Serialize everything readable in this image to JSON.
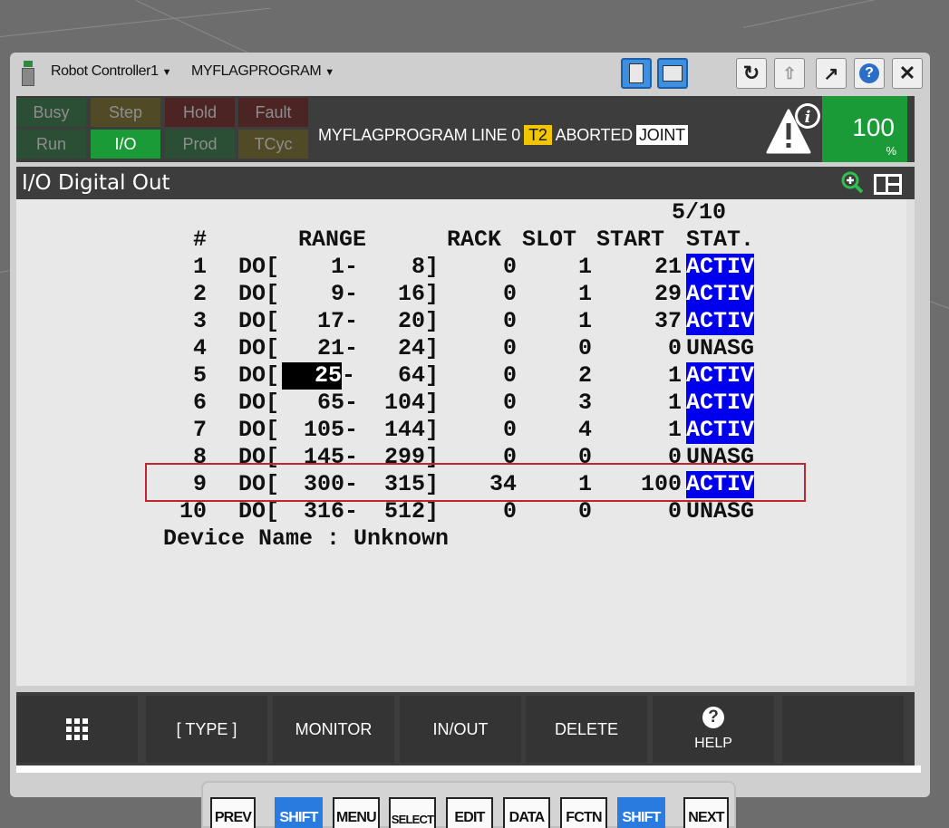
{
  "topbar": {
    "controller": "Robot Controller1",
    "program": "MYFLAGPROGRAM"
  },
  "status": {
    "busy": "Busy",
    "step": "Step",
    "hold": "Hold",
    "fault": "Fault",
    "run": "Run",
    "io": "I/O",
    "prod": "Prod",
    "tcyc": "TCyc",
    "program_line": "MYFLAGPROGRAM LINE 0",
    "mode": "T2",
    "state": "ABORTED",
    "coord": "JOINT",
    "override": "100",
    "override_unit": "%"
  },
  "screen": {
    "title": "I/O Digital Out",
    "page": "5/10",
    "headers": {
      "num": "#",
      "range": "RANGE",
      "rack": "RACK",
      "slot": "SLOT",
      "start": "START",
      "stat": "STAT."
    },
    "rows": [
      {
        "num": "1",
        "type": "DO[",
        "from": "1-",
        "to": "8]",
        "rack": "0",
        "slot": "1",
        "start": "21",
        "stat": "ACTIV"
      },
      {
        "num": "2",
        "type": "DO[",
        "from": "9-",
        "to": "16]",
        "rack": "0",
        "slot": "1",
        "start": "29",
        "stat": "ACTIV"
      },
      {
        "num": "3",
        "type": "DO[",
        "from": "17-",
        "to": "20]",
        "rack": "0",
        "slot": "1",
        "start": "37",
        "stat": "ACTIV"
      },
      {
        "num": "4",
        "type": "DO[",
        "from": "21-",
        "to": "24]",
        "rack": "0",
        "slot": "0",
        "start": "0",
        "stat": "UNASG"
      },
      {
        "num": "5",
        "type": "DO[",
        "from": "25",
        "to": "64]",
        "rack": "0",
        "slot": "2",
        "start": "1",
        "stat": "ACTIV"
      },
      {
        "num": "6",
        "type": "DO[",
        "from": "65-",
        "to": "104]",
        "rack": "0",
        "slot": "3",
        "start": "1",
        "stat": "ACTIV"
      },
      {
        "num": "7",
        "type": "DO[",
        "from": "105-",
        "to": "144]",
        "rack": "0",
        "slot": "4",
        "start": "1",
        "stat": "ACTIV"
      },
      {
        "num": "8",
        "type": "DO[",
        "from": "145-",
        "to": "299]",
        "rack": "0",
        "slot": "0",
        "start": "0",
        "stat": "UNASG"
      },
      {
        "num": "9",
        "type": "DO[",
        "from": "300-",
        "to": "315]",
        "rack": "34",
        "slot": "1",
        "start": "100",
        "stat": "ACTIV"
      },
      {
        "num": "10",
        "type": "DO[",
        "from": "316-",
        "to": "512]",
        "rack": "0",
        "slot": "0",
        "start": "0",
        "stat": "UNASG"
      }
    ],
    "cursor_dash": "-",
    "device_name": "Device Name : Unknown"
  },
  "softkeys": {
    "type": "[ TYPE ]",
    "monitor": "MONITOR",
    "inout": "IN/OUT",
    "delete": "DELETE",
    "help_icon": "?",
    "help": "HELP"
  },
  "hardkeys": {
    "prev": "PREV",
    "shift_left": "SHIFT",
    "menu": "MENU",
    "select": "SELECT",
    "edit": "EDIT",
    "data": "DATA",
    "fctn": "FCTN",
    "shift_right": "SHIFT",
    "next": "NEXT"
  },
  "colors": {
    "status_active": "#0000ee",
    "io_green": "#1b9b37",
    "mode_yellow": "#f1c500",
    "highlight_red": "#c0262e"
  }
}
